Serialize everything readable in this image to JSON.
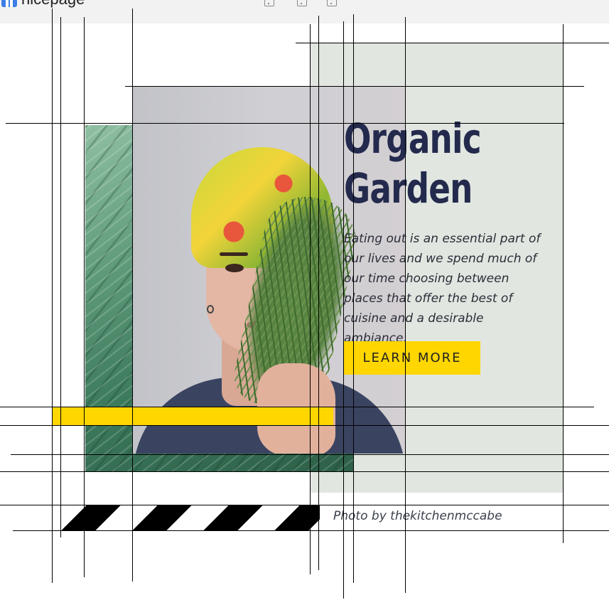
{
  "app": {
    "logo_text": "nicepage"
  },
  "toolbar": {
    "devices": [
      "desktop-icon",
      "tablet-icon",
      "phone-icon"
    ]
  },
  "hero": {
    "title_line1": "Organic",
    "title_line2": "Garden",
    "description": "Eating out is an essential part of our lives and we spend much of our time choosing between places that offer the best of cuisine and a desirable ambiance.",
    "button_label": "LEARN MORE",
    "caption": "Photo by thekitchenmccabe"
  },
  "colors": {
    "accent_yellow": "#ffd600",
    "title_navy": "#232a4d",
    "panel_green": "#e1e7e0",
    "logo_blue": "#3d7fe5"
  }
}
